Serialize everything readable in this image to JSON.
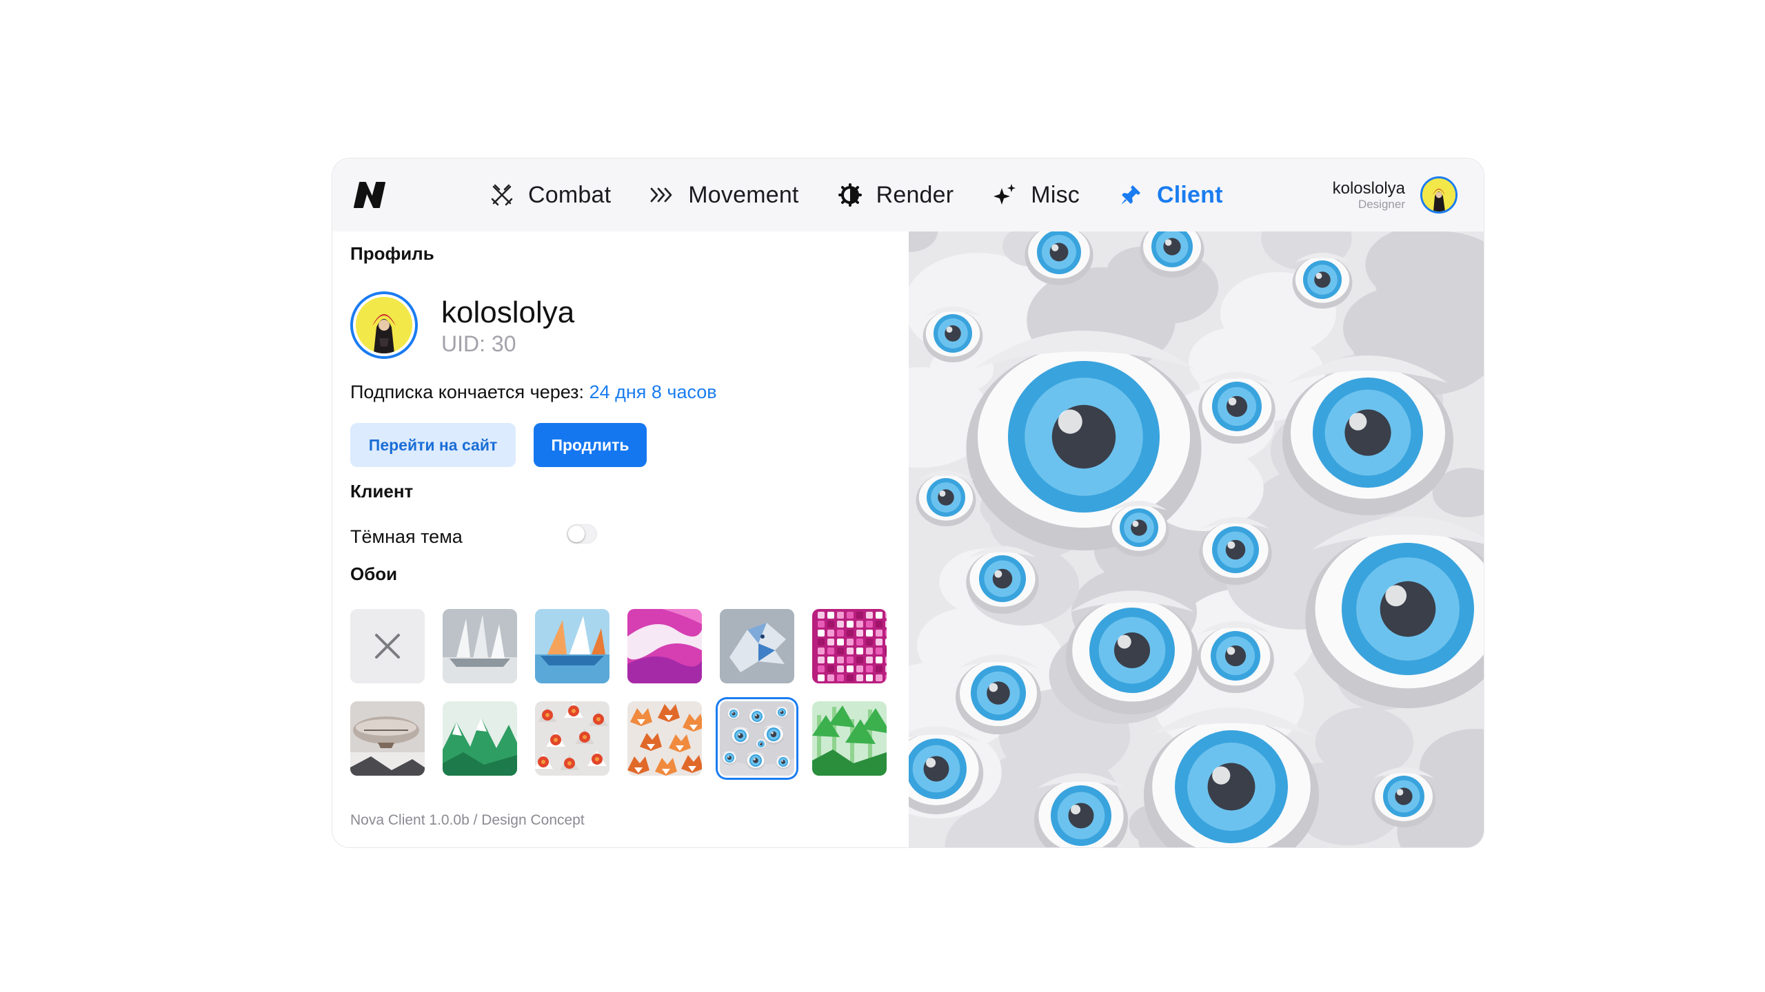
{
  "nav": {
    "items": [
      {
        "label": "Combat",
        "icon": "swords-icon"
      },
      {
        "label": "Movement",
        "icon": "chevrons-right-icon"
      },
      {
        "label": "Render",
        "icon": "half-gear-icon"
      },
      {
        "label": "Misc",
        "icon": "sparkles-icon"
      },
      {
        "label": "Client",
        "icon": "pin-icon"
      }
    ],
    "active": "Client"
  },
  "user": {
    "name": "koloslolya",
    "role": "Designer"
  },
  "profile": {
    "section_title": "Профиль",
    "name": "koloslolya",
    "uid": "UID: 30",
    "subscription_label": "Подписка кончается через:",
    "subscription_value": "24 дня 8 часов"
  },
  "buttons": {
    "site": "Перейти на сайт",
    "renew": "Продлить"
  },
  "client": {
    "section_title": "Клиент",
    "dark_theme_label": "Тёмная тема",
    "dark_theme_on": false
  },
  "wallpapers": {
    "section_title": "Обои",
    "items": [
      "none",
      "sailboats",
      "origami-boats",
      "pink-waves",
      "dragon",
      "pink-cubes",
      "airship",
      "green-mountains",
      "red-flowers",
      "foxes",
      "eyes",
      "forest"
    ],
    "selected": "eyes"
  },
  "footer": "Nova Client 1.0.0b / Design Concept",
  "colors": {
    "accent": "#1a7cf0",
    "topbar": "#f6f6f8"
  }
}
